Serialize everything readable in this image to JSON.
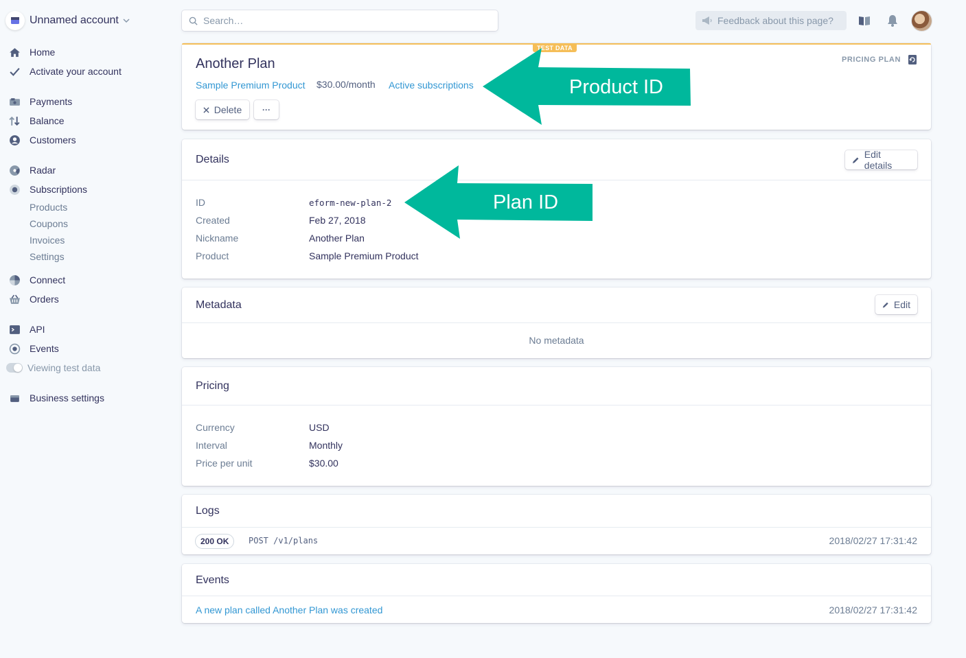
{
  "account": {
    "name": "Unnamed account"
  },
  "sidebar": {
    "items": [
      {
        "label": "Home",
        "icon": "home-icon"
      },
      {
        "label": "Activate your account",
        "icon": "check-icon"
      },
      {
        "label": "Payments",
        "icon": "payments-icon"
      },
      {
        "label": "Balance",
        "icon": "balance-icon"
      },
      {
        "label": "Customers",
        "icon": "customers-icon"
      },
      {
        "label": "Radar",
        "icon": "radar-icon"
      },
      {
        "label": "Subscriptions",
        "icon": "subscriptions-icon"
      },
      {
        "label": "Connect",
        "icon": "connect-icon"
      },
      {
        "label": "Orders",
        "icon": "orders-icon"
      },
      {
        "label": "API",
        "icon": "api-icon"
      },
      {
        "label": "Events",
        "icon": "events-icon"
      },
      {
        "label": "Business settings",
        "icon": "business-settings-icon"
      }
    ],
    "subscriptions_sub": [
      "Products",
      "Coupons",
      "Invoices",
      "Settings"
    ],
    "test_toggle_label": "Viewing test data"
  },
  "topbar": {
    "search_placeholder": "Search…",
    "feedback_label": "Feedback about this page?"
  },
  "plan": {
    "test_badge": "TEST DATA",
    "type_label": "PRICING PLAN",
    "title": "Another Plan",
    "product_link": "Sample Premium Product",
    "price": "$30.00/month",
    "subs_link": "Active subscriptions",
    "delete_label": "Delete",
    "more_label": "···"
  },
  "details": {
    "title": "Details",
    "edit_label": "Edit details",
    "rows": [
      {
        "label": "ID",
        "value": "eform-new-plan-2"
      },
      {
        "label": "Created",
        "value": "Feb 27, 2018"
      },
      {
        "label": "Nickname",
        "value": "Another Plan"
      },
      {
        "label": "Product",
        "value": "Sample Premium Product"
      }
    ]
  },
  "metadata": {
    "title": "Metadata",
    "edit_label": "Edit",
    "empty": "No metadata"
  },
  "pricing": {
    "title": "Pricing",
    "rows": [
      {
        "label": "Currency",
        "value": "USD"
      },
      {
        "label": "Interval",
        "value": "Monthly"
      },
      {
        "label": "Price per unit",
        "value": "$30.00"
      }
    ]
  },
  "logs": {
    "title": "Logs",
    "entries": [
      {
        "status": "200 OK",
        "request": "POST /v1/plans",
        "time": "2018/02/27 17:31:42"
      }
    ]
  },
  "events": {
    "title": "Events",
    "entries": [
      {
        "text": "A new plan called Another Plan was created",
        "time": "2018/02/27 17:31:42"
      }
    ]
  },
  "annotations": {
    "product_id": "Product ID",
    "plan_id": "Plan ID",
    "color": "#00b89c"
  },
  "colors": {
    "link": "#3297d3",
    "test": "#f5be58",
    "text": "#32325d"
  }
}
